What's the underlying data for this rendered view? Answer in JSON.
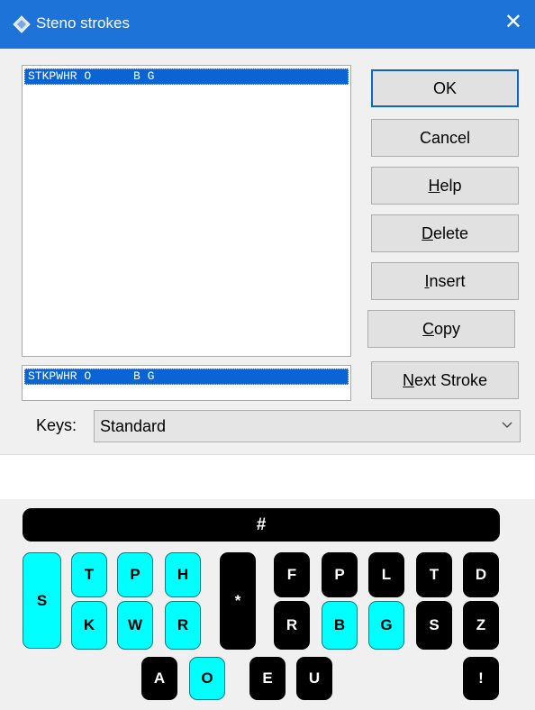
{
  "window": {
    "title": "Steno strokes",
    "close_glyph": "✕"
  },
  "list": {
    "strokes": [
      "STKPWHR O      B G"
    ],
    "current_entry": "STKPWHR O      B G"
  },
  "buttons": {
    "ok": "OK",
    "cancel": "Cancel",
    "help_accel": "H",
    "help_rest": "elp",
    "delete_accel": "D",
    "delete_rest": "elete",
    "insert_accel": "I",
    "insert_rest": "nsert",
    "copy_accel": "C",
    "copy_rest": "opy",
    "next_accel": "N",
    "next_rest": "ext Stroke"
  },
  "keys_selector": {
    "label": "Keys:",
    "value": "Standard"
  },
  "steno_keyboard": {
    "number_bar": "#",
    "keys": [
      {
        "id": "S-left",
        "label": "S",
        "pressed": true
      },
      {
        "id": "T-left",
        "label": "T",
        "pressed": true
      },
      {
        "id": "P-left",
        "label": "P",
        "pressed": true
      },
      {
        "id": "H-left",
        "label": "H",
        "pressed": true
      },
      {
        "id": "K-left",
        "label": "K",
        "pressed": true
      },
      {
        "id": "W-left",
        "label": "W",
        "pressed": true
      },
      {
        "id": "R-left",
        "label": "R",
        "pressed": true
      },
      {
        "id": "asterisk",
        "label": "*",
        "pressed": false
      },
      {
        "id": "F-right",
        "label": "F",
        "pressed": false
      },
      {
        "id": "P-right",
        "label": "P",
        "pressed": false
      },
      {
        "id": "L-right",
        "label": "L",
        "pressed": false
      },
      {
        "id": "T-right",
        "label": "T",
        "pressed": false
      },
      {
        "id": "D-right",
        "label": "D",
        "pressed": false
      },
      {
        "id": "R-right",
        "label": "R",
        "pressed": false
      },
      {
        "id": "B-right",
        "label": "B",
        "pressed": true
      },
      {
        "id": "G-right",
        "label": "G",
        "pressed": true
      },
      {
        "id": "S-right",
        "label": "S",
        "pressed": false
      },
      {
        "id": "Z-right",
        "label": "Z",
        "pressed": false
      },
      {
        "id": "A-vowel",
        "label": "A",
        "pressed": false
      },
      {
        "id": "O-vowel",
        "label": "O",
        "pressed": true
      },
      {
        "id": "E-vowel",
        "label": "E",
        "pressed": false
      },
      {
        "id": "U-vowel",
        "label": "U",
        "pressed": false
      },
      {
        "id": "exclaim",
        "label": "!",
        "pressed": false
      }
    ]
  },
  "colors": {
    "titlebar": "#1e73d8",
    "selection": "#0a64d4",
    "pressed_key": "#00ffff",
    "key": "#000000"
  }
}
